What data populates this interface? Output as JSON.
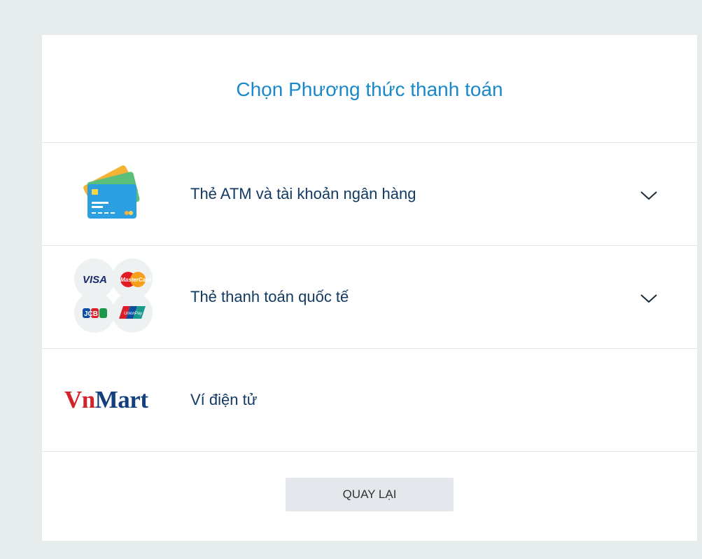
{
  "page": {
    "title": "Chọn Phương thức thanh toán"
  },
  "methods": [
    {
      "label": "Thẻ ATM và tài khoản ngân hàng",
      "icon": "atm-cards-icon",
      "expandable": true
    },
    {
      "label": "Thẻ thanh toán quốc tế",
      "icon": "international-cards-icon",
      "expandable": true,
      "logos": [
        "VISA",
        "MasterCard",
        "JCB",
        "UnionPay"
      ]
    },
    {
      "label": "Ví điện tử",
      "icon": "vnmart-logo",
      "expandable": false,
      "logo_text": {
        "vn": "Vn",
        "mart": "Mart"
      }
    }
  ],
  "footer": {
    "back_label": "QUAY LẠI"
  },
  "colors": {
    "background": "#e6ebeb",
    "title": "#1a88c9",
    "label": "#133a63",
    "button_bg": "#e4e7ec",
    "vn_red": "#d2232a",
    "mart_blue": "#13407d"
  }
}
